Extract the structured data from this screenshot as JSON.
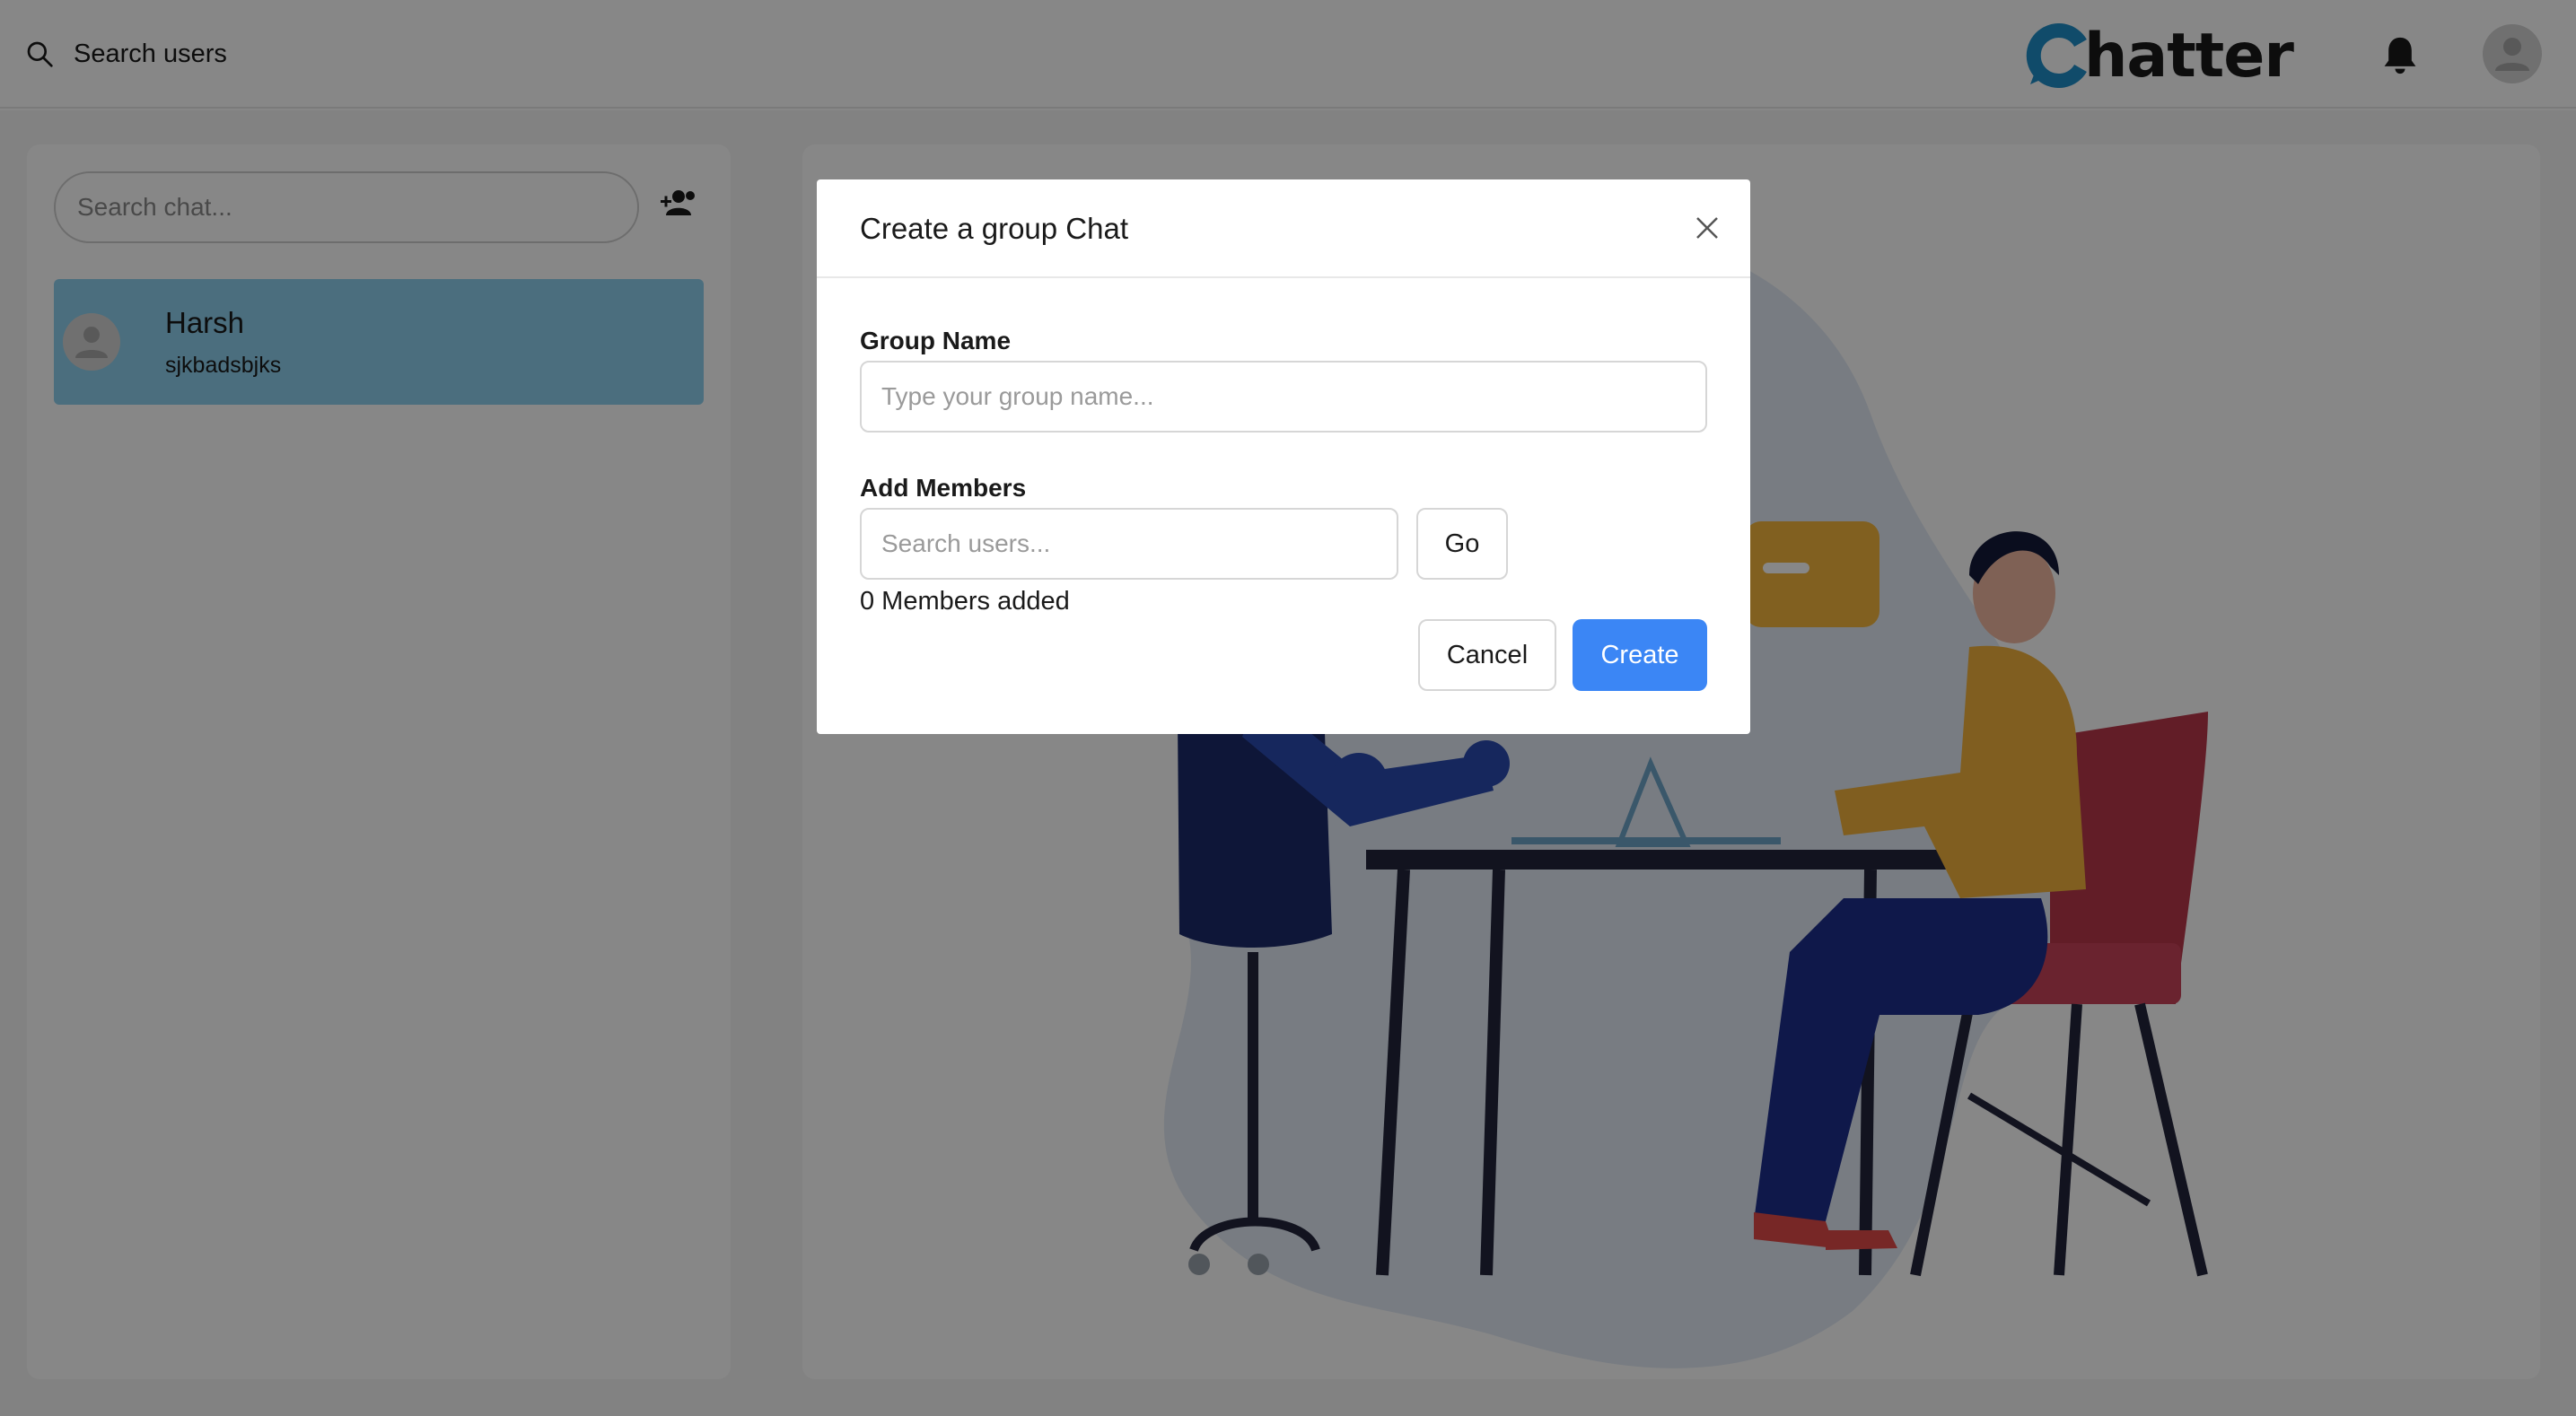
{
  "header": {
    "search_label": "Search users",
    "logo_text": "hatter",
    "logo_icon": "chat-c-icon",
    "notification_icon": "bell-icon",
    "avatar_icon": "user-avatar-icon"
  },
  "sidebar": {
    "search_placeholder": "Search chat...",
    "add_group_icon": "add-user-icon",
    "chats": [
      {
        "name": "Harsh",
        "preview": "sjkbadsbjks",
        "selected": true
      }
    ],
    "selected_color": "#8ed0ee"
  },
  "modal": {
    "title": "Create a group Chat",
    "close_icon": "close-icon",
    "group_name_label": "Group Name",
    "group_name_placeholder": "Type your group name...",
    "add_members_label": "Add Members",
    "search_users_placeholder": "Search users...",
    "go_label": "Go",
    "members_added": "0 Members added",
    "cancel_label": "Cancel",
    "create_label": "Create",
    "primary_color": "#3b86f5"
  }
}
